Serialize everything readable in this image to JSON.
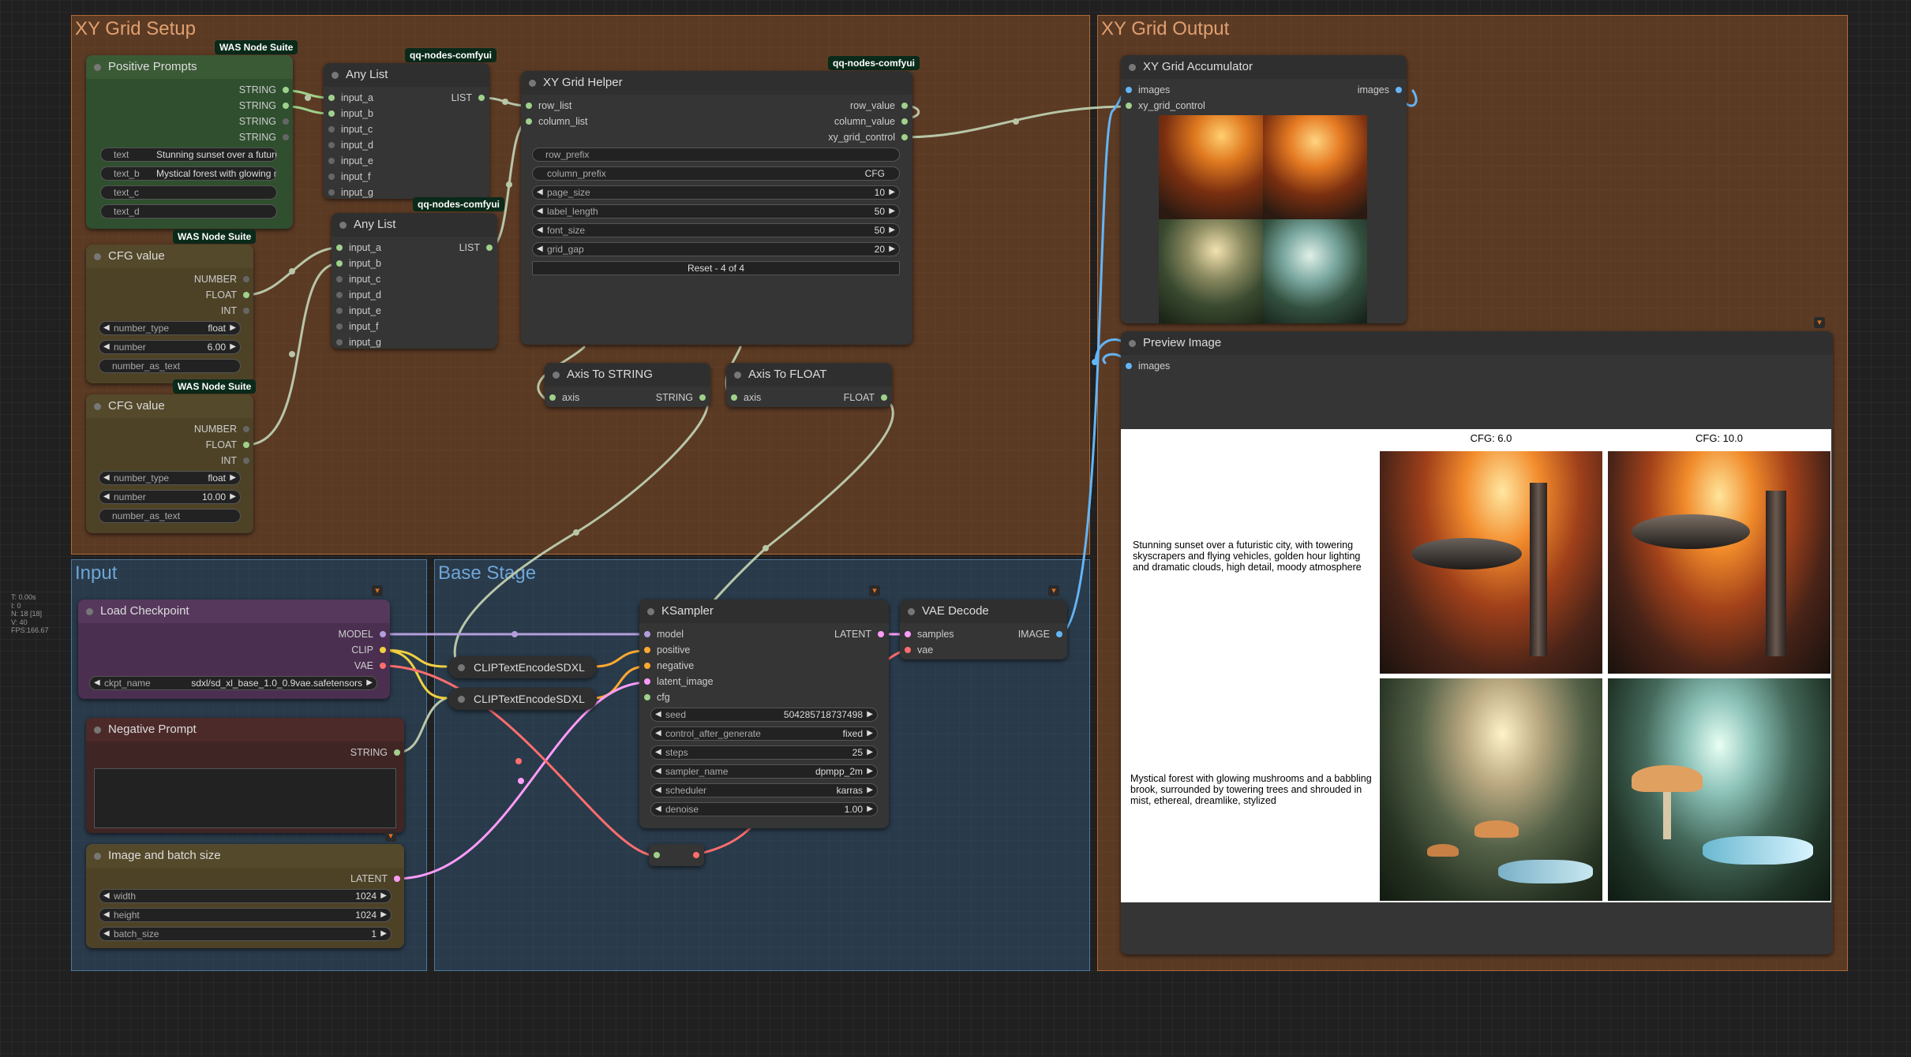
{
  "groups": {
    "xy_setup": "XY Grid Setup",
    "xy_output": "XY Grid Output",
    "input": "Input",
    "base_stage": "Base Stage"
  },
  "stats": {
    "t": "T: 0.00s",
    "i": "I: 0",
    "n": "N: 18 [18]",
    "v": "V: 40",
    "fps": "FPS:166.67"
  },
  "badges": {
    "was": "WAS Node Suite",
    "qq": "qq-nodes-comfyui"
  },
  "positive_prompts": {
    "title": "Positive Prompts",
    "outputs": [
      "STRING",
      "STRING",
      "STRING",
      "STRING"
    ],
    "text_label": "text",
    "text_value": "Stunning sunset over a futuris",
    "text_b_label": "text_b",
    "text_b_value": "Mystical forest with glowing m",
    "text_c_label": "text_c",
    "text_d_label": "text_d"
  },
  "any_list_1": {
    "title": "Any List",
    "inputs": [
      "input_a",
      "input_b",
      "input_c",
      "input_d",
      "input_e",
      "input_f",
      "input_g"
    ],
    "output": "LIST"
  },
  "any_list_2": {
    "title": "Any List",
    "inputs": [
      "input_a",
      "input_b",
      "input_c",
      "input_d",
      "input_e",
      "input_f",
      "input_g"
    ],
    "output": "LIST"
  },
  "xy_helper": {
    "title": "XY Grid Helper",
    "inputs": [
      "row_list",
      "column_list"
    ],
    "outputs": [
      "row_value",
      "column_value",
      "xy_grid_control"
    ],
    "row_prefix": "row_prefix",
    "column_prefix_label": "column_prefix",
    "column_prefix_value": "CFG",
    "page_size_label": "page_size",
    "page_size_value": "10",
    "label_length_label": "label_length",
    "label_length_value": "50",
    "font_size_label": "font_size",
    "font_size_value": "50",
    "grid_gap_label": "grid_gap",
    "grid_gap_value": "20",
    "reset": "Reset - 4 of 4"
  },
  "cfg_value_1": {
    "title": "CFG value",
    "outputs": [
      "NUMBER",
      "FLOAT",
      "INT"
    ],
    "number_type_label": "number_type",
    "number_type_value": "float",
    "number_label": "number",
    "number_value": "6.00",
    "number_as_text": "number_as_text"
  },
  "cfg_value_2": {
    "title": "CFG value",
    "outputs": [
      "NUMBER",
      "FLOAT",
      "INT"
    ],
    "number_type_label": "number_type",
    "number_type_value": "float",
    "number_label": "number",
    "number_value": "10.00",
    "number_as_text": "number_as_text"
  },
  "axis_string": {
    "title": "Axis To STRING",
    "input": "axis",
    "output": "STRING"
  },
  "axis_float": {
    "title": "Axis To FLOAT",
    "input": "axis",
    "output": "FLOAT"
  },
  "accumulator": {
    "title": "XY Grid Accumulator",
    "inputs": [
      "images",
      "xy_grid_control"
    ],
    "output": "images"
  },
  "preview": {
    "title": "Preview Image",
    "input": "images",
    "col_headers": [
      "CFG: 6.0",
      "CFG: 10.0"
    ],
    "row_labels": [
      "Stunning sunset over a futuristic city, with towering skyscrapers and flying vehicles, golden hour lighting and dramatic clouds, high detail, moody atmosphere",
      "Mystical forest with glowing mushrooms and a babbling brook, surrounded by towering trees and shrouded in mist, ethereal, dreamlike, stylized"
    ]
  },
  "load_checkpoint": {
    "title": "Load Checkpoint",
    "outputs": [
      "MODEL",
      "CLIP",
      "VAE"
    ],
    "ckpt_label": "ckpt_name",
    "ckpt_value": "sdxl/sd_xl_base_1.0_0.9vae.safetensors"
  },
  "clip1": "CLIPTextEncodeSDXL",
  "clip2": "CLIPTextEncodeSDXL",
  "negative": {
    "title": "Negative Prompt",
    "output": "STRING"
  },
  "image_batch": {
    "title": "Image and batch size",
    "output": "LATENT",
    "width_label": "width",
    "width_value": "1024",
    "height_label": "height",
    "height_value": "1024",
    "batch_label": "batch_size",
    "batch_value": "1"
  },
  "ksampler": {
    "title": "KSampler",
    "inputs": [
      "model",
      "positive",
      "negative",
      "latent_image",
      "cfg"
    ],
    "output": "LATENT",
    "seed_label": "seed",
    "seed_value": "504285718737498",
    "cag_label": "control_after_generate",
    "cag_value": "fixed",
    "steps_label": "steps",
    "steps_value": "25",
    "sampler_label": "sampler_name",
    "sampler_value": "dpmpp_2m",
    "scheduler_label": "scheduler",
    "scheduler_value": "karras",
    "denoise_label": "denoise",
    "denoise_value": "1.00"
  },
  "vae_decode": {
    "title": "VAE Decode",
    "inputs": [
      "samples",
      "vae"
    ],
    "output": "IMAGE"
  },
  "colors": {
    "string": "#9fd18a",
    "float": "#aad",
    "int": "#aaa",
    "model": "#b39ddb",
    "clip": "#f0d040",
    "vae": "#ff6e6e",
    "latent": "#ff9cf9",
    "image": "#64b5f6",
    "conditioning": "#ffa931"
  },
  "icons": {
    "fox": "fox-icon"
  }
}
